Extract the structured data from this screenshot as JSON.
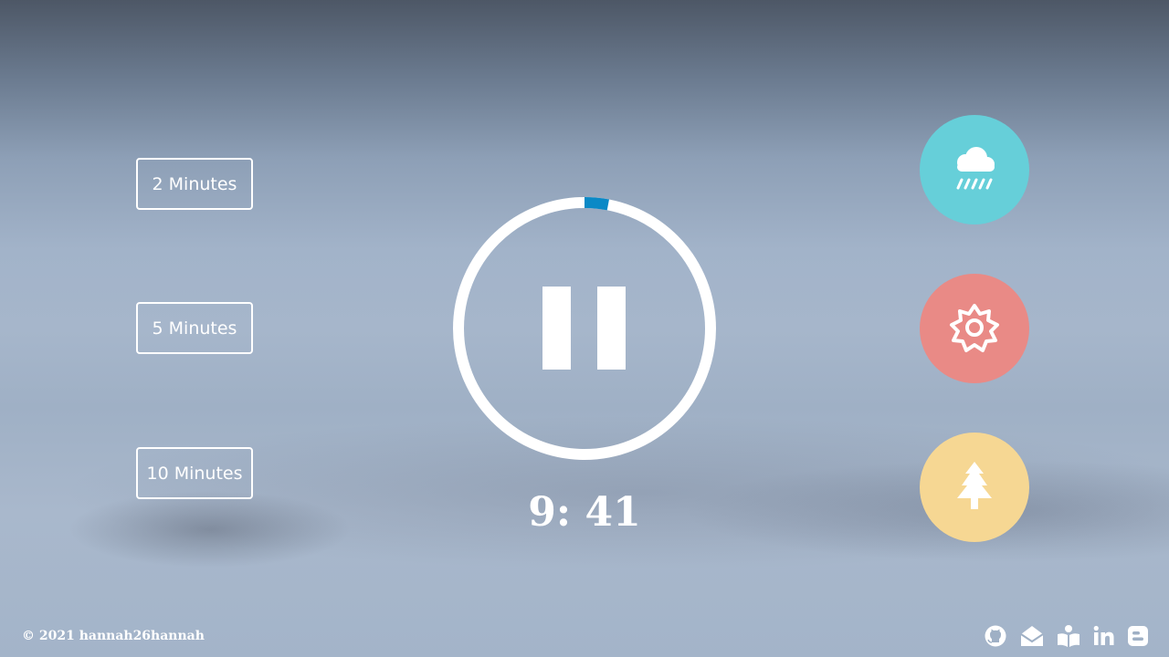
{
  "durations": [
    {
      "label": "2 Minutes"
    },
    {
      "label": "5 Minutes"
    },
    {
      "label": "10 Minutes"
    }
  ],
  "timer": {
    "display": "9: 41",
    "state": "playing",
    "progress_fraction": 0.03,
    "ring_color": "#ffffff",
    "progress_color": "#0a89c6"
  },
  "sounds": [
    {
      "name": "rain",
      "icon": "cloud-rain-icon",
      "color": "#66cfd9"
    },
    {
      "name": "summer",
      "icon": "sun-icon",
      "color": "#e98a86"
    },
    {
      "name": "winter",
      "icon": "tree-icon",
      "color": "#f6d793"
    }
  ],
  "footer": {
    "copyright": "© 2021 hannah26hannah",
    "social_icons": [
      "github-icon",
      "mail-icon",
      "reader-icon",
      "linkedin-icon",
      "blogger-icon"
    ]
  }
}
